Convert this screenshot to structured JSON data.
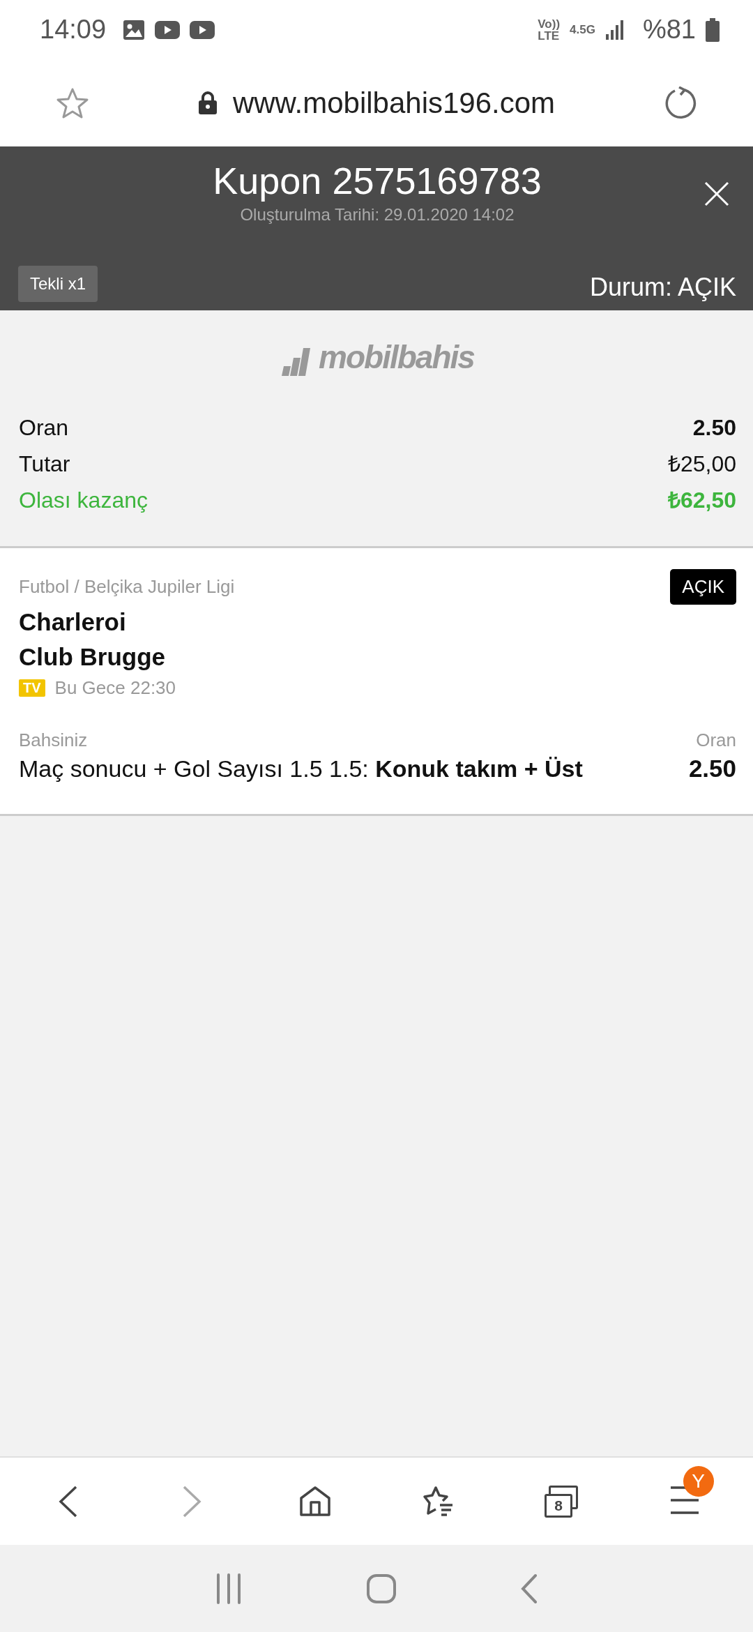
{
  "status_bar": {
    "time": "14:09",
    "volte": [
      "Vo))",
      "LTE"
    ],
    "network": "4.5G",
    "battery": "%81"
  },
  "browser": {
    "url": "www.mobilbahis196.com"
  },
  "header": {
    "title": "Kupon 2575169783",
    "subtitle": "Oluşturulma Tarihi: 29.01.2020 14:02",
    "type_tag": "Tekli x1",
    "status": "Durum: AÇIK"
  },
  "summary": {
    "logo": "mobilbahis",
    "rows": [
      {
        "label": "Oran",
        "value": "2.50",
        "kind": "bold"
      },
      {
        "label": "Tutar",
        "value": "₺25,00",
        "kind": "plain"
      },
      {
        "label": "Olası kazanç",
        "value": "₺62,50",
        "kind": "win"
      }
    ]
  },
  "bet": {
    "league": "Futbol / Belçika Jupiler Ligi",
    "status_tag": "AÇIK",
    "home": "Charleroi",
    "away": "Club Brugge",
    "tv": "TV",
    "time": "Bu Gece 22:30",
    "pick_label": "Bahsiniz",
    "odds_label": "Oran",
    "pick": "Maç sonucu + Gol Sayısı 1.5 1.5: **Konuk takım + Üst**",
    "odds": "2.50"
  },
  "nav": [
    {
      "kind": "back",
      "disabled": false
    },
    {
      "kind": "forward",
      "disabled": true
    },
    {
      "kind": "home",
      "disabled": false
    },
    {
      "kind": "bookmarks",
      "disabled": false
    },
    {
      "kind": "tabs",
      "disabled": false,
      "count": "8"
    },
    {
      "kind": "menu",
      "disabled": false,
      "badge": "Y"
    }
  ]
}
